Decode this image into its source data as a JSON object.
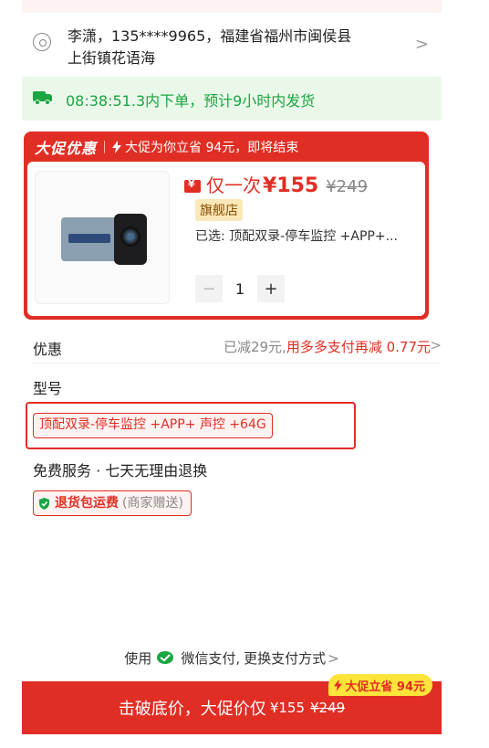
{
  "address": {
    "line1": "李潇，135****9965，福建省福州市闽侯县",
    "line2": "上街镇花语海"
  },
  "shipping": {
    "text": "08:38:51.3内下单，预计9小时内发货",
    "color": "#1aa641"
  },
  "promo": {
    "tag": "大促优惠",
    "message": "大促为你立省 94元，即将结束",
    "accent": "#e02e24"
  },
  "product": {
    "price_label": "仅一次",
    "price_now": "¥155",
    "price_old": "¥249",
    "store_badge": "旗舰店",
    "variant": "已选: 顶配双录-停车监控 +APP+...",
    "quantity": "1"
  },
  "discount": {
    "label": "优惠",
    "applied": "已减29元,",
    "extra": "用多多支付再减 0.77元"
  },
  "model": {
    "title": "型号",
    "selected": "顶配双录-停车监控 +APP+ 声控 +64G"
  },
  "service": {
    "title": "免费服务 · 七天无理由退换",
    "chip_strong": "退货包运费",
    "chip_muted": "(商家赠送)"
  },
  "payment": {
    "prefix": "使用",
    "method": "微信支付,",
    "suffix": "更换支付方式"
  },
  "cta": {
    "label": "击破底价，大促价仅",
    "price": "¥155",
    "old_price": "¥249",
    "badge": "大促立省 94元"
  }
}
